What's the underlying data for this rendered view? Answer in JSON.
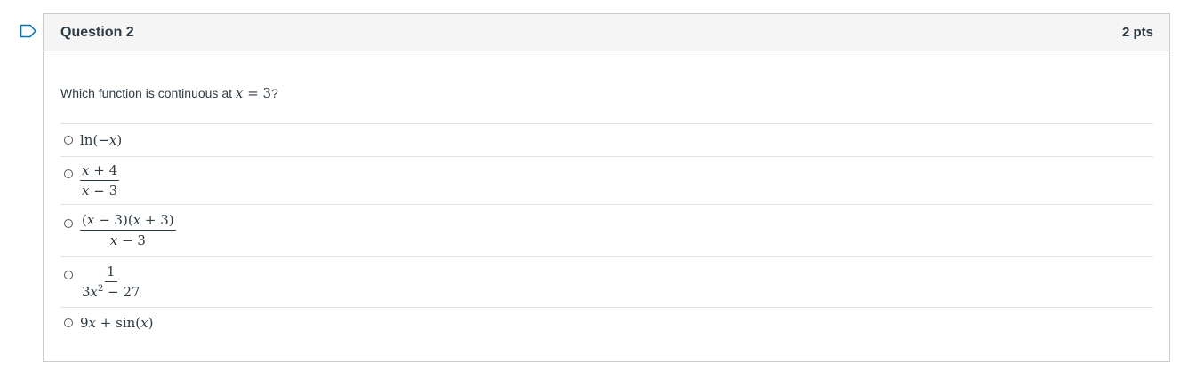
{
  "question": {
    "title": "Question 2",
    "points": "2 pts",
    "prompt_text": "Which function is continuous at ",
    "prompt_math": "x = 3",
    "prompt_suffix": "?"
  },
  "answers": [
    {
      "type": "inline",
      "math": "ln(−x)"
    },
    {
      "type": "fraction",
      "numerator": "x + 4",
      "denominator": "x − 3"
    },
    {
      "type": "fraction",
      "numerator": "(x − 3)(x + 3)",
      "denominator": "x − 3"
    },
    {
      "type": "fraction",
      "numerator": "1",
      "denominator": "3x² − 27"
    },
    {
      "type": "inline",
      "math": "9x + sin(x)"
    }
  ],
  "colors": {
    "header_bg": "#f5f5f5",
    "border": "#c7cdd1",
    "divider": "#dfe3e6",
    "text": "#2d3b45",
    "flag": "#0374b5"
  },
  "icons": {
    "flag": "flag-bookmark-icon",
    "radio": "radio-button-icon"
  }
}
